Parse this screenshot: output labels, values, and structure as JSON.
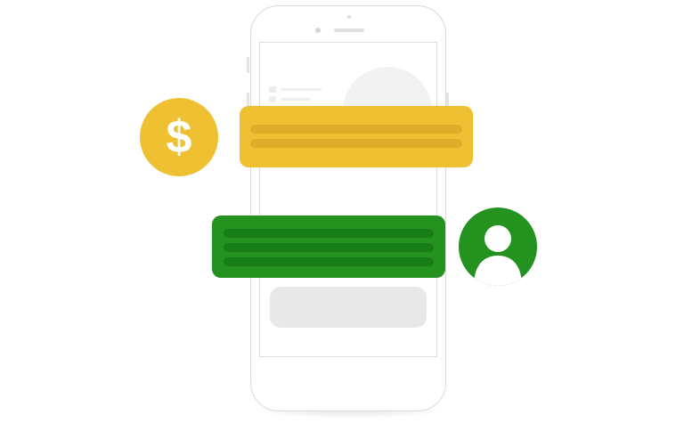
{
  "colors": {
    "payment_accent": "#EEC032",
    "payment_line": "#DEAC29",
    "user_accent": "#23921F",
    "user_line": "#167D17",
    "phone_outline": "#DADADA",
    "screen_placeholder": "#E8E8E8"
  },
  "icons": {
    "coin": "dollar-sign-icon",
    "avatar": "user-icon"
  },
  "content": {
    "dollar_symbol": "$"
  }
}
